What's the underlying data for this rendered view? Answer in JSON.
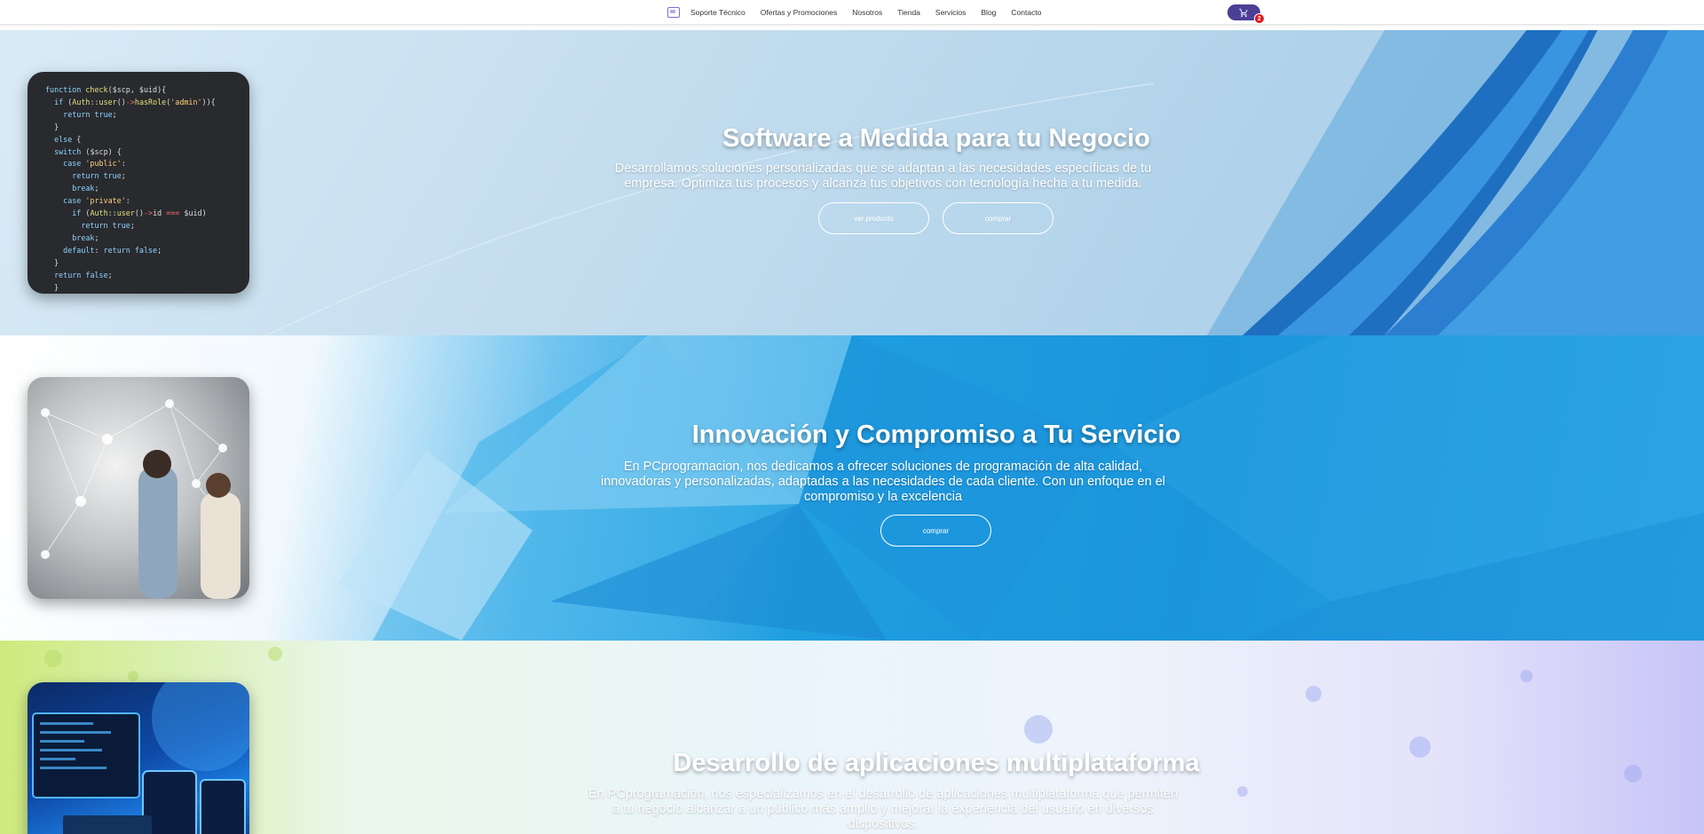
{
  "nav": {
    "items": [
      {
        "label": "Soporte Técnico"
      },
      {
        "label": "Ofertas y Promociones"
      },
      {
        "label": "Nosotros"
      },
      {
        "label": "Tienda"
      },
      {
        "label": "Servicios"
      },
      {
        "label": "Blog"
      },
      {
        "label": "Contacto"
      }
    ],
    "cart_count": "2"
  },
  "slides": [
    {
      "title": "Software a Medida para tu Negocio",
      "text_line1": "Desarrollamos soluciones personalizadas que se adaptan a las necesidades específicas de tu",
      "text_line2": "empresa. Optimiza tus procesos y alcanza tus objetivos con tecnología hecha a tu medida.",
      "btn_primary": "ver producto",
      "btn_secondary": "comprar"
    },
    {
      "title": "Innovación y Compromiso a Tu Servicio",
      "text_line1": "En PCprogramacion, nos dedicamos a ofrecer soluciones de programación de alta calidad,",
      "text_line2": "innovadoras y personalizadas, adaptadas a las necesidades de cada cliente. Con un enfoque en el",
      "text_line3": "compromiso y la excelencia",
      "btn_primary": "comprar"
    },
    {
      "title": "Desarrollo de aplicaciones multiplataforma",
      "text_line1": "En PCprogramación, nos especializamos en el desarrollo de aplicaciones multiplataforma que permiten",
      "text_line2": "a tu negocio alcanzar a un público más amplio y mejorar la experiencia del usuario en diversos",
      "text_line3": "dispositivos."
    }
  ],
  "code_snippet": {
    "lines": [
      "function check($scp, $uid){",
      "  if (Auth::user()->hasRole('admin')){",
      "    return true;",
      "  }",
      "  else {",
      "  switch ($scp) {",
      "    case 'public':",
      "      return true;",
      "      break;",
      "    case 'private':",
      "      if (Auth::user()->id === $uid)",
      "        return true;",
      "      break;",
      "    default: return false;",
      "  }",
      "  return false;",
      "  }",
      "}"
    ]
  }
}
